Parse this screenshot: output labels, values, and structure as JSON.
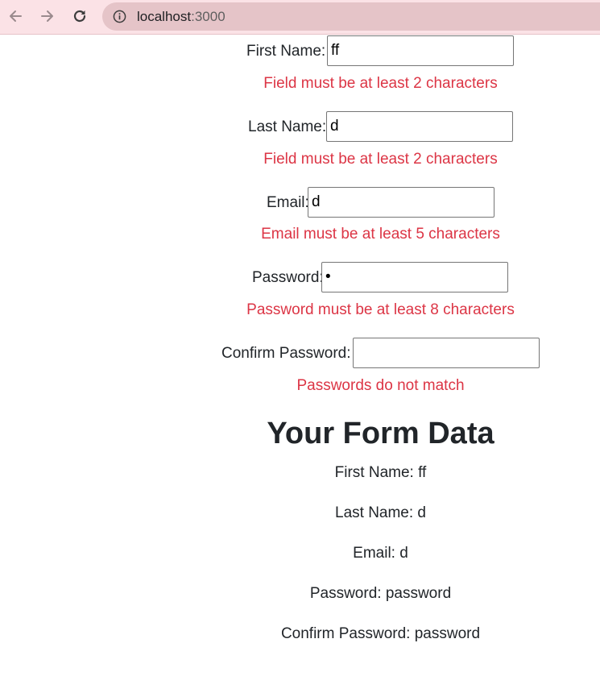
{
  "browser": {
    "url_host": "localhost",
    "url_port": ":3000"
  },
  "form": {
    "first_name": {
      "label": "First Name:",
      "value": "ff",
      "error": "Field must be at least 2 characters"
    },
    "last_name": {
      "label": "Last Name:",
      "value": "d",
      "error": "Field must be at least 2 characters"
    },
    "email": {
      "label": "Email:",
      "value": "d",
      "error": "Email must be at least 5 characters"
    },
    "password": {
      "label": "Password:",
      "value": "•",
      "error": "Password must be at least 8 characters"
    },
    "confirm_password": {
      "label": "Confirm Password:",
      "value": "",
      "error": "Passwords do not match"
    }
  },
  "summary": {
    "heading": "Your Form Data",
    "first_name": "First Name: ff",
    "last_name": "Last Name: d",
    "email": "Email: d",
    "password": "Password: password",
    "confirm_password": "Confirm Password: password"
  },
  "colors": {
    "error": "#dc3545",
    "toolbar": "#fbe2e6",
    "omnibox": "#e5c4c8"
  }
}
